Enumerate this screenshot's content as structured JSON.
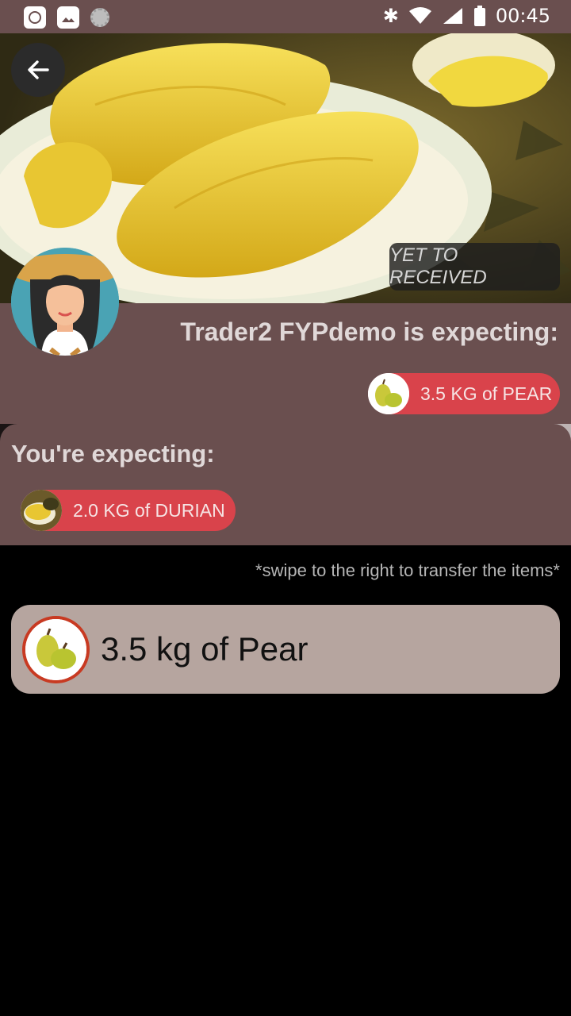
{
  "status_bar": {
    "time": "00:45"
  },
  "icons": {
    "back": "arrow-left-icon",
    "pear": "pear-icon",
    "durian": "durian-icon",
    "avatar": "avatar-woman-icon"
  },
  "header": {
    "status_label": "YET TO RECEIVED"
  },
  "trader": {
    "title": "Trader2 FYPdemo is expecting:",
    "chip_label": "3.5 KG of PEAR"
  },
  "you": {
    "title": "You're expecting:",
    "chip_label": "2.0 KG of DURIAN"
  },
  "hint": "*swipe to the right to transfer the items*",
  "item": {
    "label": "3.5 kg of Pear"
  },
  "colors": {
    "panel": "#6a4f4f",
    "chip": "#d9434b",
    "card": "#b6a59f",
    "ring": "#c83a22"
  }
}
